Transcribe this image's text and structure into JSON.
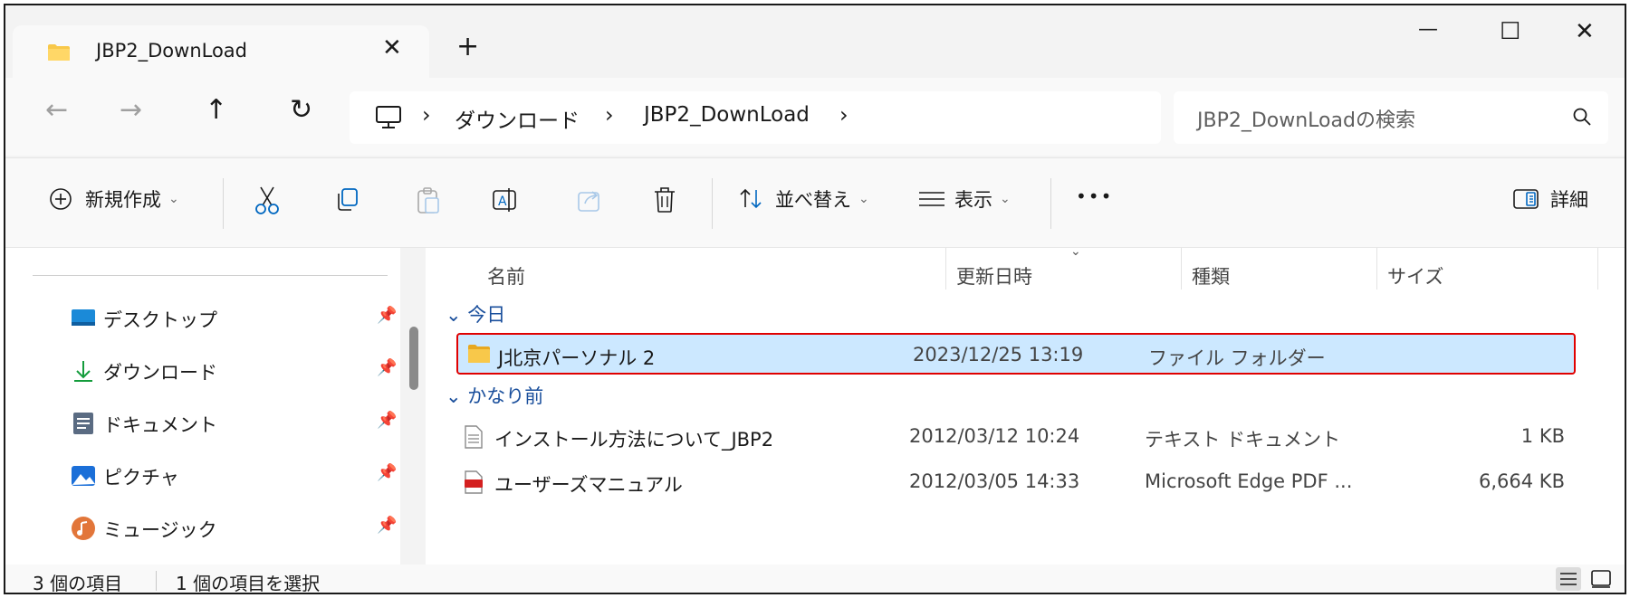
{
  "tab": {
    "title": "JBP2_DownLoad",
    "close": "✕",
    "new_tab": "+"
  },
  "window_controls": {
    "minimize": "—",
    "maximize": "☐",
    "close": "✕"
  },
  "nav": {
    "back": "←",
    "forward": "→",
    "up": "↑",
    "refresh": "↻"
  },
  "breadcrumb": {
    "separator": "›",
    "items": [
      "ダウンロード",
      "JBP2_DownLoad"
    ]
  },
  "search": {
    "placeholder": "JBP2_DownLoadの検索"
  },
  "commands": {
    "new": "新規作成",
    "sort": "並べ替え",
    "view": "表示",
    "more": "•••",
    "details": "詳細"
  },
  "sidebar": {
    "items": [
      {
        "label": "デスクトップ",
        "icon": "desktop-icon"
      },
      {
        "label": "ダウンロード",
        "icon": "download-icon"
      },
      {
        "label": "ドキュメント",
        "icon": "document-icon"
      },
      {
        "label": "ピクチャ",
        "icon": "pictures-icon"
      },
      {
        "label": "ミュージック",
        "icon": "music-icon"
      }
    ]
  },
  "columns": {
    "name": "名前",
    "date": "更新日時",
    "type": "種類",
    "size": "サイズ"
  },
  "groups": {
    "today": "今日",
    "long_ago": "かなり前"
  },
  "files": [
    {
      "name": "J北京パーソナル 2",
      "date": "2023/12/25 13:19",
      "type": "ファイル フォルダー",
      "size": "",
      "icon": "folder-icon",
      "selected": true
    },
    {
      "name": "インストール方法について_JBP2",
      "date": "2012/03/12 10:24",
      "type": "テキスト ドキュメント",
      "size": "1 KB",
      "icon": "text-file-icon",
      "selected": false
    },
    {
      "name": "ユーザーズマニュアル",
      "date": "2012/03/05 14:33",
      "type": "Microsoft Edge PDF ...",
      "size": "6,664 KB",
      "icon": "pdf-file-icon",
      "selected": false
    }
  ],
  "status": {
    "count": "3 個の項目",
    "selected": "1 個の項目を選択"
  },
  "colors": {
    "accent": "#0067c0",
    "selection": "#cce8ff",
    "highlight_border": "#e00000",
    "folder": "#f8c84a"
  }
}
